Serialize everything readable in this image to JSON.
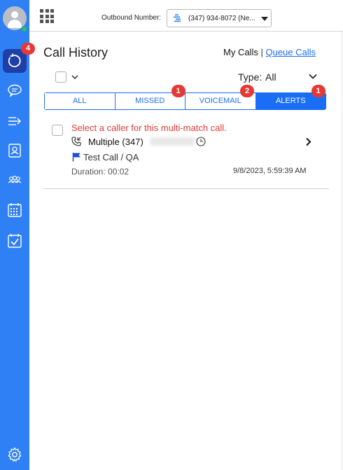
{
  "sidebar": {
    "nav_badge_count": "4",
    "items": [
      {
        "name": "recent-calls-icon",
        "active": true
      },
      {
        "name": "chat-icon"
      },
      {
        "name": "transfer-icon"
      },
      {
        "name": "contacts-icon"
      },
      {
        "name": "team-icon"
      },
      {
        "name": "calendar-icon"
      },
      {
        "name": "tasks-icon"
      }
    ],
    "settings_icon": "gear-icon",
    "accent_color": "#2f80f5",
    "active_color": "#1e3fa8"
  },
  "header": {
    "outbound_label": "Outbound Number:",
    "outbound_value": "(347) 934-8072 (Ne..."
  },
  "main": {
    "title": "Call History",
    "my_calls": "My Calls",
    "separator": "|",
    "queue_calls": "Queue Calls",
    "type_label": "Type:",
    "type_value": "All",
    "tabs": [
      {
        "label": "ALL",
        "badge": ""
      },
      {
        "label": "MISSED",
        "badge": "1"
      },
      {
        "label": "VOICEMAIL",
        "badge": "2"
      },
      {
        "label": "ALERTS",
        "badge": "1"
      }
    ],
    "active_tab": "ALERTS"
  },
  "call": {
    "alert": "Select a caller for this multi-match call.",
    "caller": "Multiple",
    "number_prefix": "(347)",
    "tag": "Test Call / QA",
    "duration": "Duration: 00:02",
    "timestamp": "9/8/2023, 5:59:39 AM",
    "alert_color": "#e53935",
    "link_color": "#1a6ef5"
  }
}
